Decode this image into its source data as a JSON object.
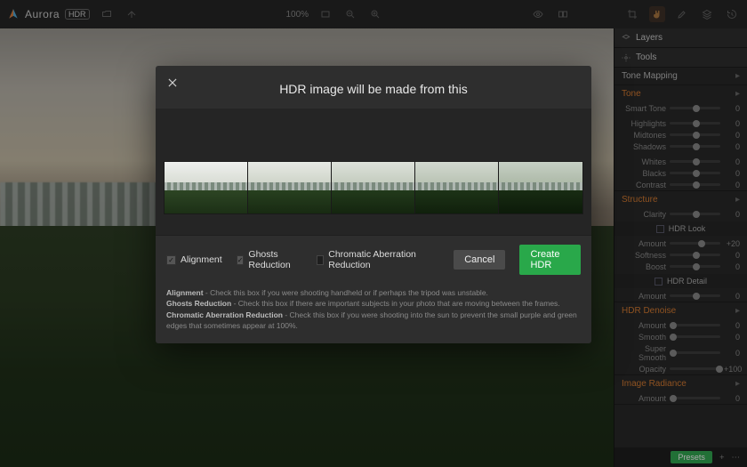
{
  "app": {
    "name": "Aurora",
    "badge": "HDR"
  },
  "toolbar": {
    "zoom": "100%"
  },
  "modal": {
    "title": "HDR image will be made from this",
    "options": {
      "alignment": {
        "label": "Alignment",
        "checked": true
      },
      "ghosts": {
        "label": "Ghosts Reduction",
        "checked": true
      },
      "chromatic": {
        "label": "Chromatic Aberration Reduction",
        "checked": false
      }
    },
    "buttons": {
      "cancel": "Cancel",
      "create": "Create HDR"
    },
    "hints": {
      "alignment": "Alignment",
      "alignment_text": " - Check this box if you were shooting handheld or if perhaps the tripod was unstable.",
      "ghosts": "Ghosts Reduction",
      "ghosts_text": " - Check this box if there are important subjects in your photo that are moving between the frames.",
      "chromatic": "Chromatic Aberration Reduction",
      "chromatic_text": " - Check this box if you were shooting into the sun to prevent the small purple and green edges that sometimes appear at 100%."
    }
  },
  "sidebar": {
    "layers_title": "Layers",
    "tools_title": "Tools",
    "panels": {
      "tone_mapping": "Tone Mapping",
      "tone": "Tone",
      "structure": "Structure",
      "hdr_look": "HDR Look",
      "hdr_detail": "HDR Detail",
      "hdr_denoise": "HDR Denoise",
      "image_radiance": "Image Radiance"
    },
    "sliders": {
      "smart_tone": "Smart Tone",
      "highlights": "Highlights",
      "midtones": "Midtones",
      "shadows": "Shadows",
      "whites": "Whites",
      "blacks": "Blacks",
      "contrast": "Contrast",
      "clarity": "Clarity",
      "amount": "Amount",
      "softness": "Softness",
      "boost": "Boost",
      "smooth": "Smooth",
      "super_smooth": "Super Smooth",
      "opacity": "Opacity"
    },
    "values": {
      "zero": "0",
      "plus20": "+20",
      "plus100": "+100"
    },
    "presets": "Presets"
  }
}
